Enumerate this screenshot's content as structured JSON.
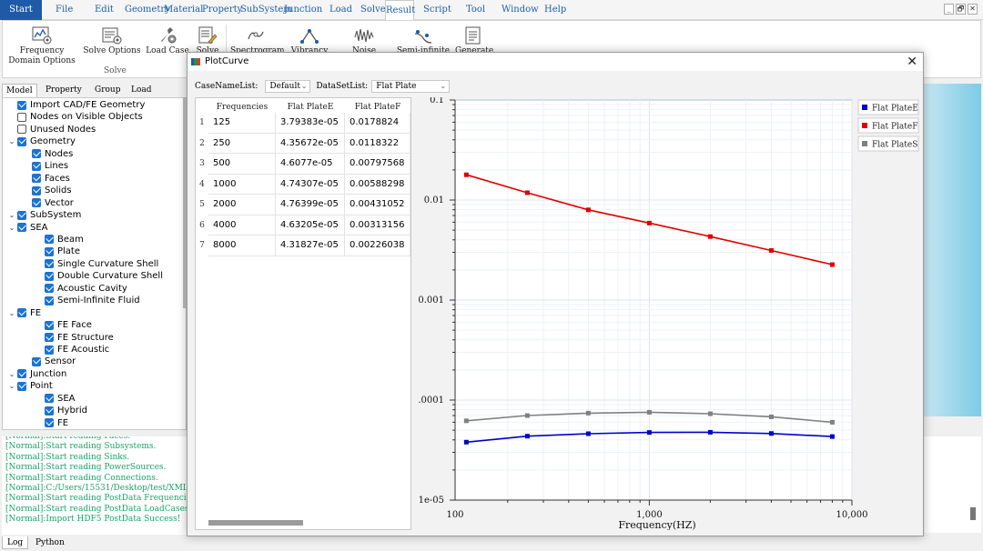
{
  "menu": {
    "start": "Start",
    "file": "File",
    "edit": "Edit",
    "geometry": "Geometry",
    "material": "Material",
    "property": "Property",
    "subsystem": "SubSystem",
    "junction": "Junction",
    "load": "Load",
    "solve": "Solve",
    "result": "Result",
    "script": "Script",
    "tool": "Tool",
    "window": "Window",
    "help": "Help",
    "minimize": "_",
    "restore": "🗗",
    "close": "✕"
  },
  "ribbon": {
    "frequency_domain_options": "Frequency Domain Options",
    "solve_options": "Solve Options",
    "load_case": "Load Case",
    "solve": "Solve",
    "group_solve": "Solve",
    "spectrogram": "Spectrogram",
    "vibrancy": "Vibrancy",
    "noise": "Noise",
    "semi_infinite": "Semi-infinite",
    "generate": "Generate"
  },
  "left_tabs": {
    "model": "Model",
    "property": "Property",
    "group": "Group",
    "load": "Load"
  },
  "tree": [
    {
      "label": "Import CAD/FE Geometry",
      "checked": true,
      "level": 1
    },
    {
      "label": "Nodes on Visible Objects",
      "checked": false,
      "level": 1
    },
    {
      "label": "Unused Nodes",
      "checked": false,
      "level": 1
    },
    {
      "label": "Geometry",
      "checked": true,
      "level": 0,
      "expanded": true
    },
    {
      "label": "Nodes",
      "checked": true,
      "level": 2
    },
    {
      "label": "Lines",
      "checked": true,
      "level": 2
    },
    {
      "label": "Faces",
      "checked": true,
      "level": 2
    },
    {
      "label": "Solids",
      "checked": true,
      "level": 2
    },
    {
      "label": "Vector",
      "checked": true,
      "level": 2
    },
    {
      "label": "SubSystem",
      "checked": true,
      "level": 0,
      "expanded": true
    },
    {
      "label": "SEA",
      "checked": true,
      "level": 1,
      "expanded": true
    },
    {
      "label": "Beam",
      "checked": true,
      "level": 3
    },
    {
      "label": "Plate",
      "checked": true,
      "level": 3
    },
    {
      "label": "Single Curvature Shell",
      "checked": true,
      "level": 3,
      "selected": true
    },
    {
      "label": "Double Curvature Shell",
      "checked": true,
      "level": 3
    },
    {
      "label": "Acoustic Cavity",
      "checked": true,
      "level": 3
    },
    {
      "label": "Semi-Infinite Fluid",
      "checked": true,
      "level": 3
    },
    {
      "label": "FE",
      "checked": true,
      "level": 1,
      "expanded": true
    },
    {
      "label": "FE Face",
      "checked": true,
      "level": 3
    },
    {
      "label": "FE Structure",
      "checked": true,
      "level": 3
    },
    {
      "label": "FE Acoustic",
      "checked": true,
      "level": 3
    },
    {
      "label": "Sensor",
      "checked": true,
      "level": 2
    },
    {
      "label": "Junction",
      "checked": true,
      "level": 0,
      "expanded": true
    },
    {
      "label": "Point",
      "checked": true,
      "level": 1,
      "expanded": true
    },
    {
      "label": "SEA",
      "checked": true,
      "level": 3
    },
    {
      "label": "Hybrid",
      "checked": true,
      "level": 3
    },
    {
      "label": "FE",
      "checked": true,
      "level": 3
    }
  ],
  "log": [
    "[Normal]:Start reading Faces.",
    "[Normal]:Start reading Subsystems.",
    "[Normal]:Start reading Sinks.",
    "[Normal]:Start reading PowerSources.",
    "[Normal]:Start reading Connections.",
    "[Normal]:C:/Users/15531/Desktop/test/XML/",
    "[Normal]:Start reading PostData Frequenci",
    "[Normal]:Start reading PostData LoadCases",
    "[Normal]:Import HDF5 PostData Success!"
  ],
  "bottom_tabs": {
    "log": "Log",
    "python": "Python"
  },
  "dialog": {
    "title": "PlotCurve",
    "close": "✕",
    "case_label": "CaseNameList:",
    "case_value": "Default",
    "dataset_label": "DataSetList:",
    "dataset_value": "Flat Plate",
    "combo_arrow": "⌄"
  },
  "table": {
    "headers": [
      "Frequencies",
      "Flat PlateE",
      "Flat PlateF"
    ],
    "rows": [
      [
        "125",
        "3.79383e-05",
        "0.0178824"
      ],
      [
        "250",
        "4.35672e-05",
        "0.0118322"
      ],
      [
        "500",
        "4.6077e-05",
        "0.00797568"
      ],
      [
        "1000",
        "4.74307e-05",
        "0.00588298"
      ],
      [
        "2000",
        "4.76399e-05",
        "0.00431052"
      ],
      [
        "4000",
        "4.63205e-05",
        "0.00313156"
      ],
      [
        "8000",
        "4.31827e-05",
        "0.00226038"
      ]
    ],
    "row_numbers": [
      "1",
      "2",
      "3",
      "4",
      "5",
      "6",
      "7"
    ]
  },
  "chart_data": {
    "type": "line",
    "x_scale": "log",
    "y_scale": "log",
    "xlabel": "Frequency(HZ)",
    "ylabel": "",
    "xlim": [
      110,
      10000
    ],
    "ylim": [
      1e-05,
      0.1
    ],
    "x_ticks": [
      100,
      1000,
      10000
    ],
    "x_tick_labels": [
      "100",
      "1,000",
      "10,000"
    ],
    "y_ticks": [
      0.1,
      0.01,
      0.001,
      0.0001,
      1e-05
    ],
    "y_tick_labels": [
      "0.1",
      "0.01",
      "0.001",
      "0.0001",
      "1e-05"
    ],
    "grid": true,
    "legend_position": "right",
    "x": [
      125,
      250,
      500,
      1000,
      2000,
      4000,
      8000
    ],
    "series": [
      {
        "name": "Flat PlateE",
        "color": "#0000cc",
        "values": [
          3.79383e-05,
          4.35672e-05,
          4.6077e-05,
          4.74307e-05,
          4.76399e-05,
          4.63205e-05,
          4.31827e-05
        ]
      },
      {
        "name": "Flat PlateF",
        "color": "#e00000",
        "values": [
          0.0178824,
          0.0118322,
          0.00797568,
          0.00588298,
          0.00431052,
          0.00313156,
          0.00226038
        ]
      },
      {
        "name": "Flat PlateS",
        "color": "#808080",
        "values": [
          6.2e-05,
          7e-05,
          7.4e-05,
          7.55e-05,
          7.3e-05,
          6.8e-05,
          6e-05
        ]
      }
    ]
  },
  "colors": {
    "accent": "#1e5aa8",
    "log_text": "#19a56b",
    "checkbox": "#1b73d2"
  }
}
